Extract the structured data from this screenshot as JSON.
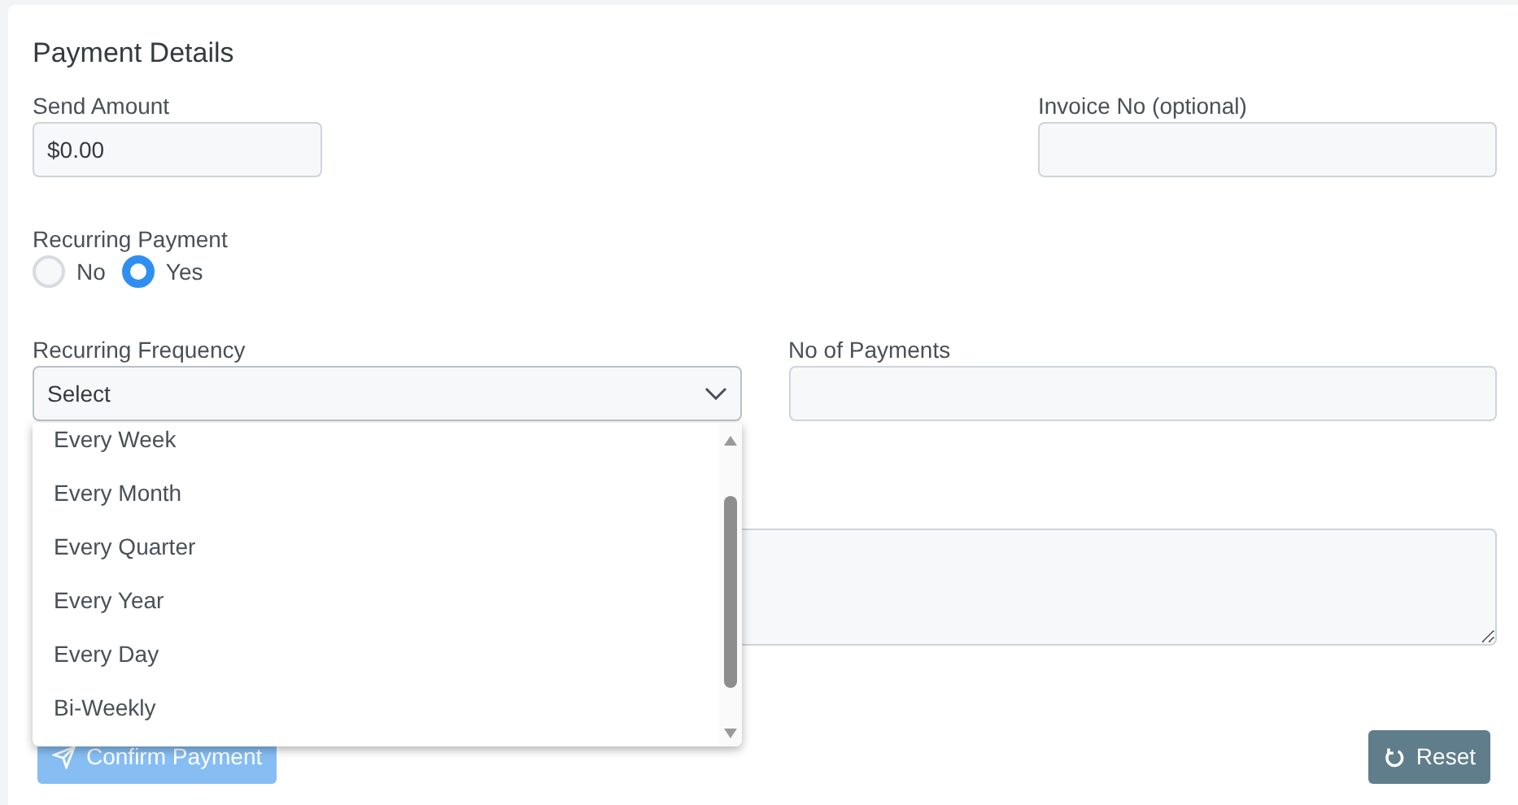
{
  "title": "Payment Details",
  "send_amount": {
    "label": "Send Amount",
    "value": "$0.00"
  },
  "invoice": {
    "label": "Invoice No (optional)"
  },
  "recurring_payment": {
    "label": "Recurring Payment",
    "options": [
      {
        "label": "No",
        "selected": false
      },
      {
        "label": "Yes",
        "selected": true
      }
    ]
  },
  "recurring_frequency": {
    "label": "Recurring Frequency",
    "value": "Select",
    "expanded": true,
    "options": [
      {
        "label": "Every Week"
      },
      {
        "label": "Every Month"
      },
      {
        "label": "Every Quarter"
      },
      {
        "label": "Every Year"
      },
      {
        "label": "Every Day"
      },
      {
        "label": "Bi-Weekly"
      }
    ]
  },
  "no_of_payments": {
    "label": "No of Payments"
  },
  "buttons": [
    {
      "kind": "primary",
      "label": "Confirm Payment",
      "disabled": true
    },
    {
      "kind": "reset",
      "label": "Reset",
      "disabled": false
    }
  ]
}
